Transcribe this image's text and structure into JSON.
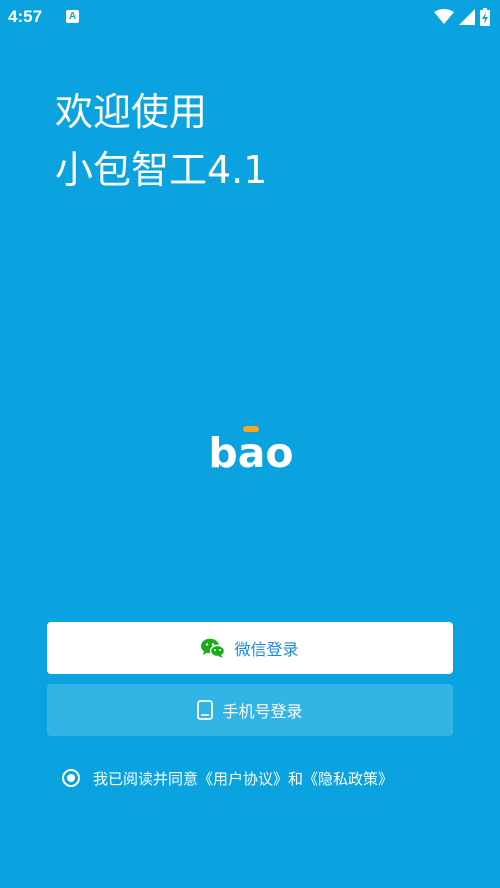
{
  "status_bar": {
    "time": "4:57",
    "notification_icon_letter": "A",
    "icons": [
      "wifi-icon",
      "signal-icon",
      "battery-charging-icon"
    ]
  },
  "welcome": {
    "line1": "欢迎使用",
    "line2": "小包智工4.1"
  },
  "logo": {
    "text": "bao",
    "accent_color": "#f5a623"
  },
  "buttons": {
    "wechat_login": "微信登录",
    "phone_login": "手机号登录"
  },
  "agreement": {
    "prefix": "我已阅读并同意",
    "user_agreement": "《用户协议》",
    "conjunction": "和",
    "privacy_policy": "《隐私政策》",
    "checked": true
  },
  "colors": {
    "background": "#0aa3df",
    "wechat_green": "#1aad19",
    "wechat_text": "#1e8bd8"
  }
}
